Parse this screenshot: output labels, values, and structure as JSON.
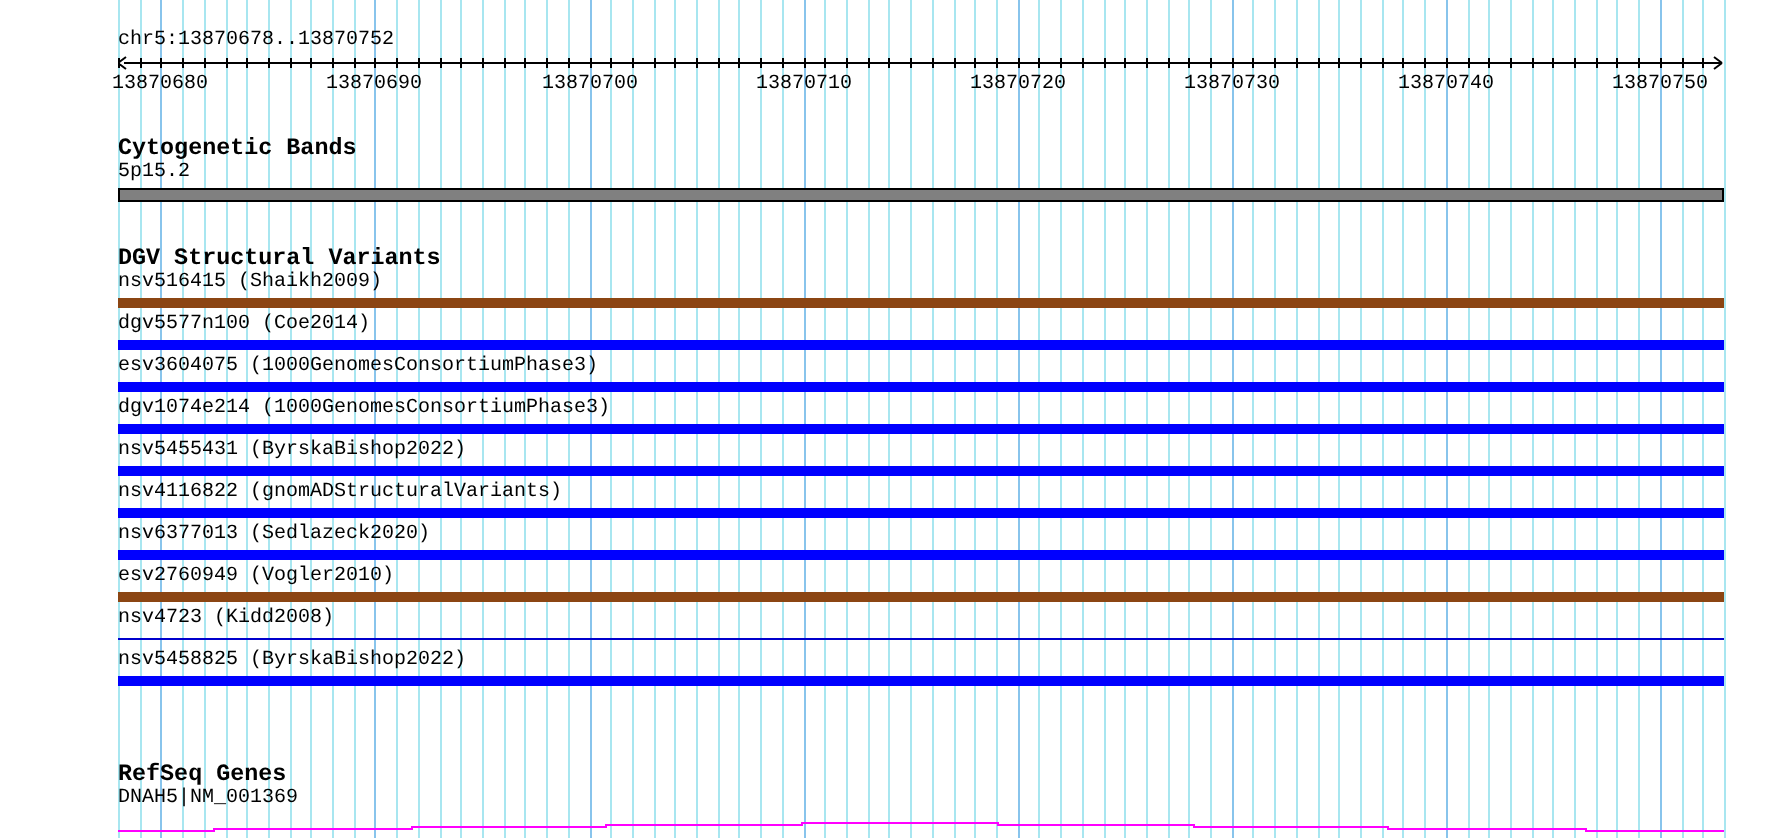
{
  "ruler": {
    "location": "chr5:13870678..13870752",
    "ticks": [
      "13870680",
      "13870690",
      "13870700",
      "13870710",
      "13870720",
      "13870730",
      "13870740",
      "13870750"
    ]
  },
  "tracks": [
    {
      "kind": "cytoband",
      "title": "Cytogenetic Bands",
      "features": [
        {
          "label": "5p15.2",
          "color": "#808080"
        }
      ]
    },
    {
      "kind": "variants",
      "title": "DGV Structural Variants",
      "features": [
        {
          "label": "nsv516415 (Shaikh2009)",
          "color": "#8b4513",
          "kind": "thick"
        },
        {
          "label": "dgv5577n100 (Coe2014)",
          "color": "#0000ff",
          "kind": "thick"
        },
        {
          "label": "esv3604075 (1000GenomesConsortiumPhase3)",
          "color": "#0000ff",
          "kind": "thick"
        },
        {
          "label": "dgv1074e214 (1000GenomesConsortiumPhase3)",
          "color": "#0000ff",
          "kind": "thick"
        },
        {
          "label": "nsv5455431 (ByrskaBishop2022)",
          "color": "#0000ff",
          "kind": "thick"
        },
        {
          "label": "nsv4116822 (gnomADStructuralVariants)",
          "color": "#0000ff",
          "kind": "thick"
        },
        {
          "label": "nsv6377013 (Sedlazeck2020)",
          "color": "#0000ff",
          "kind": "thick"
        },
        {
          "label": "esv2760949 (Vogler2010)",
          "color": "#8b4513",
          "kind": "thick"
        },
        {
          "label": "nsv4723 (Kidd2008)",
          "color": "#0000cc",
          "kind": "thin"
        },
        {
          "label": "nsv5458825 (ByrskaBishop2022)",
          "color": "#0000ff",
          "kind": "thick"
        }
      ]
    },
    {
      "kind": "genes",
      "title": "RefSeq Genes",
      "features": [
        {
          "label": "DNAH5|NM_001369",
          "color": "#ff00ff"
        }
      ]
    }
  ]
}
